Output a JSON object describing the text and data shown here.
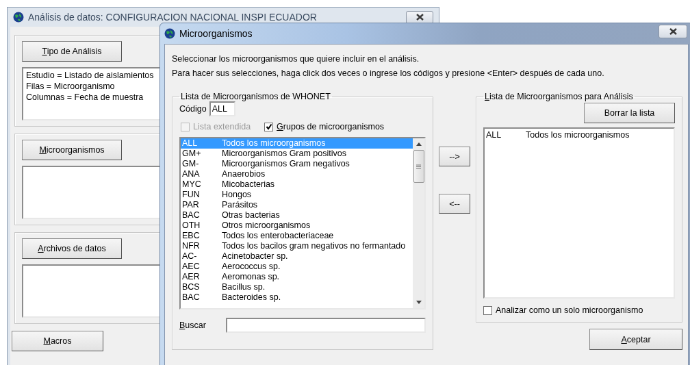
{
  "main_window": {
    "title": "Análisis de datos:  CONFIGURACION NACIONAL INSPI ECUADOR",
    "sections": [
      {
        "button": {
          "label": "Tipo de Análisis",
          "mnemonic": true
        },
        "lines": [
          "Estudio = Listado de aislamientos",
          "Filas = Microorganismo",
          "Columnas = Fecha de muestra"
        ]
      },
      {
        "button": {
          "label": "Microorganismos",
          "mnemonic": true
        }
      },
      {
        "button": {
          "label": "Archivos de datos",
          "mnemonic": true
        }
      }
    ],
    "macros_button": {
      "label": "Macros",
      "mnemonic": true
    }
  },
  "dialog": {
    "title": "Microorganismos",
    "instructions": [
      "Seleccionar los microorganismos que quiere incluir en el análisis.",
      "Para hacer sus selecciones, haga click dos veces o ingrese los códigos y presione <Enter> después de cada uno."
    ],
    "source_group": {
      "label": "Lista de Microorganismos de WHONET",
      "code_label": "Código",
      "code_value": "ALL",
      "options": [
        {
          "label": "Lista extendida",
          "checked": false,
          "disabled": true,
          "mnemonic": false
        },
        {
          "label": "Grupos de microorganismos",
          "checked": true,
          "disabled": false,
          "mnemonic": true
        }
      ],
      "items": [
        {
          "code": "ALL",
          "name": "Todos los microorganismos",
          "selected": true
        },
        {
          "code": "GM+",
          "name": "Microorganismos Gram positivos",
          "selected": false
        },
        {
          "code": "GM-",
          "name": "Microorganismos Gram negativos",
          "selected": false
        },
        {
          "code": "ANA",
          "name": "Anaerobios",
          "selected": false
        },
        {
          "code": "MYC",
          "name": "Micobacterias",
          "selected": false
        },
        {
          "code": "FUN",
          "name": "Hongos",
          "selected": false
        },
        {
          "code": "PAR",
          "name": "Parásitos",
          "selected": false
        },
        {
          "code": "BAC",
          "name": "Otras bacterias",
          "selected": false
        },
        {
          "code": "OTH",
          "name": "Otros microorganismos",
          "selected": false
        },
        {
          "code": "EBC",
          "name": "Todos los enterobacteriaceae",
          "selected": false
        },
        {
          "code": "NFR",
          "name": "Todos los bacilos gram negativos no fermantado",
          "selected": false
        },
        {
          "code": "AC-",
          "name": "Acinetobacter sp.",
          "selected": false
        },
        {
          "code": "AEC",
          "name": "Aerococcus sp.",
          "selected": false
        },
        {
          "code": "AER",
          "name": "Aeromonas sp.",
          "selected": false
        },
        {
          "code": "BCS",
          "name": "Bacillus sp.",
          "selected": false
        },
        {
          "code": "BAC",
          "name": "Bacteroides sp.",
          "selected": false
        }
      ],
      "search_label": "Buscar"
    },
    "add_button": "-->",
    "remove_button": "<--",
    "target_group": {
      "label": "Lista de Microorganismos para Análisis",
      "clear_button": "Borrar la lista",
      "items": [
        {
          "code": "ALL",
          "name": "Todos los microorganismos",
          "selected": false
        }
      ],
      "single_option": {
        "label": "Analizar como un solo microorganismo",
        "checked": false
      }
    },
    "accept_button": {
      "label": "Aceptar",
      "mnemonic": true
    }
  }
}
